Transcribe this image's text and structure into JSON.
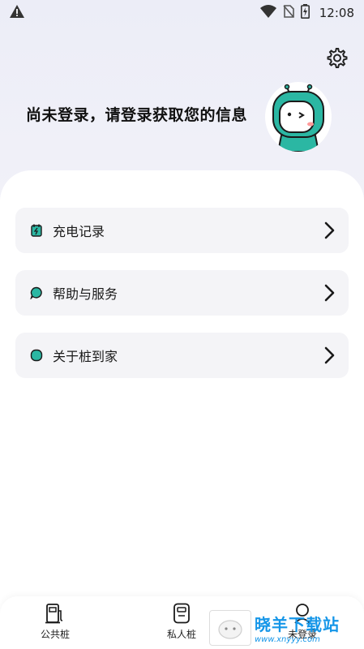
{
  "status_bar": {
    "time": "12:08",
    "icons": [
      "warning-icon",
      "wifi-icon",
      "no-sim-icon",
      "battery-charging-icon"
    ]
  },
  "header": {
    "settings_icon": "gear-icon",
    "login_prompt": "尚未登录，请登录获取您的信息",
    "avatar": "robot-avatar"
  },
  "menu": {
    "items": [
      {
        "label": "充电记录",
        "icon": "charging-record-icon"
      },
      {
        "label": "帮助与服务",
        "icon": "help-service-icon"
      },
      {
        "label": "关于桩到家",
        "icon": "about-icon"
      }
    ]
  },
  "tabbar": {
    "tabs": [
      {
        "label": "公共桩",
        "icon": "public-charger-icon"
      },
      {
        "label": "私人桩",
        "icon": "private-charger-icon"
      },
      {
        "label": "未登录",
        "icon": "user-icon"
      }
    ]
  },
  "watermark": {
    "title": "晓羊下载站",
    "url": "www.xnyyy.com"
  },
  "colors": {
    "accent": "#2bb7a3",
    "watermark_blue": "#1596e8"
  }
}
